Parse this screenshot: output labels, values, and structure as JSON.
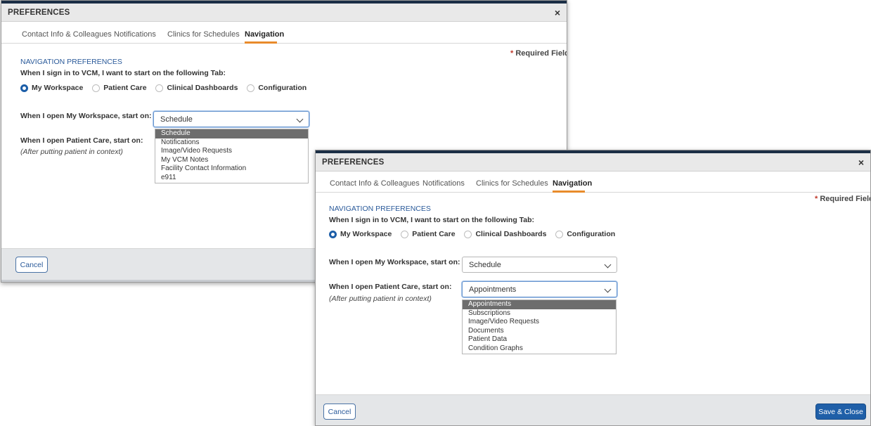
{
  "dialog_back": {
    "title": "PREFERENCES",
    "close": "×",
    "tabs": [
      {
        "label": "Contact Info & Colleagues"
      },
      {
        "label": "Notifications"
      },
      {
        "label": "Clinics for Schedules"
      },
      {
        "label": "Navigation"
      }
    ],
    "required": {
      "star": "*",
      "text": "Required Field"
    },
    "section_title": "NAVIGATION PREFERENCES",
    "start_tab_question": "When I sign in to VCM, I want to start on the following Tab:",
    "radios": [
      {
        "label": "My Workspace",
        "selected": true
      },
      {
        "label": "Patient Care",
        "selected": false
      },
      {
        "label": "Clinical Dashboards",
        "selected": false
      },
      {
        "label": "Configuration",
        "selected": false
      }
    ],
    "workspace_label": "When I open My Workspace, start on:",
    "workspace_value": "Schedule",
    "workspace_options": [
      "Schedule",
      "Notifications",
      "Image/Video Requests",
      "My VCM Notes",
      "Facility Contact Information",
      "e911"
    ],
    "patient_label": "When I open Patient Care, start on:",
    "patient_note": "(After putting patient in context)",
    "cancel_label": "Cancel"
  },
  "dialog_front": {
    "title": "PREFERENCES",
    "close": "×",
    "tabs": [
      {
        "label": "Contact Info & Colleagues"
      },
      {
        "label": "Notifications"
      },
      {
        "label": "Clinics for Schedules"
      },
      {
        "label": "Navigation"
      }
    ],
    "required": {
      "star": "*",
      "text": "Required Field"
    },
    "section_title": "NAVIGATION PREFERENCES",
    "start_tab_question": "When I sign in to VCM, I want to start on the following Tab:",
    "radios": [
      {
        "label": "My Workspace",
        "selected": true
      },
      {
        "label": "Patient Care",
        "selected": false
      },
      {
        "label": "Clinical Dashboards",
        "selected": false
      },
      {
        "label": "Configuration",
        "selected": false
      }
    ],
    "workspace_label": "When I open My Workspace, start on:",
    "workspace_value": "Schedule",
    "patient_label": "When I open Patient Care, start on:",
    "patient_note": "(After putting patient in context)",
    "patient_value": "Appointments",
    "patient_options": [
      "Appointments",
      "Subscriptions",
      "Image/Video Requests",
      "Documents",
      "Patient Data",
      "Condition Graphs"
    ],
    "cancel_label": "Cancel",
    "save_label": "Save & Close"
  },
  "colors": {
    "accent": "#1f5fa8",
    "tab_underline": "#e88b2b",
    "section": "#2a5a9a",
    "selected_option": "#6d6d6d"
  }
}
